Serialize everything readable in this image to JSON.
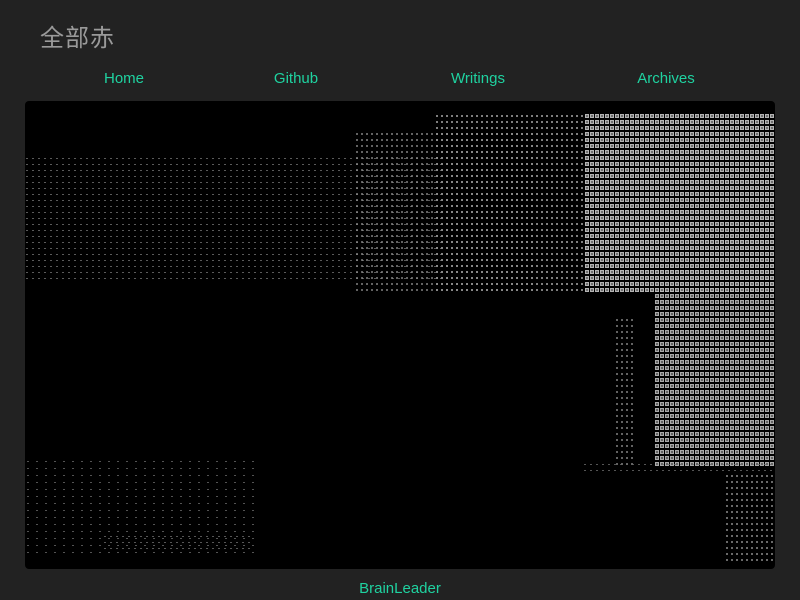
{
  "site": {
    "title": "全部赤"
  },
  "nav": {
    "items": [
      {
        "label": "Home"
      },
      {
        "label": "Github"
      },
      {
        "label": "Writings"
      },
      {
        "label": "Archives"
      }
    ]
  },
  "footer": {
    "link_label": "BrainLeader"
  },
  "colors": {
    "background": "#222222",
    "accent": "#1fd2a0",
    "title_text": "#9a9a9a",
    "ascii_panel": "#000000"
  }
}
